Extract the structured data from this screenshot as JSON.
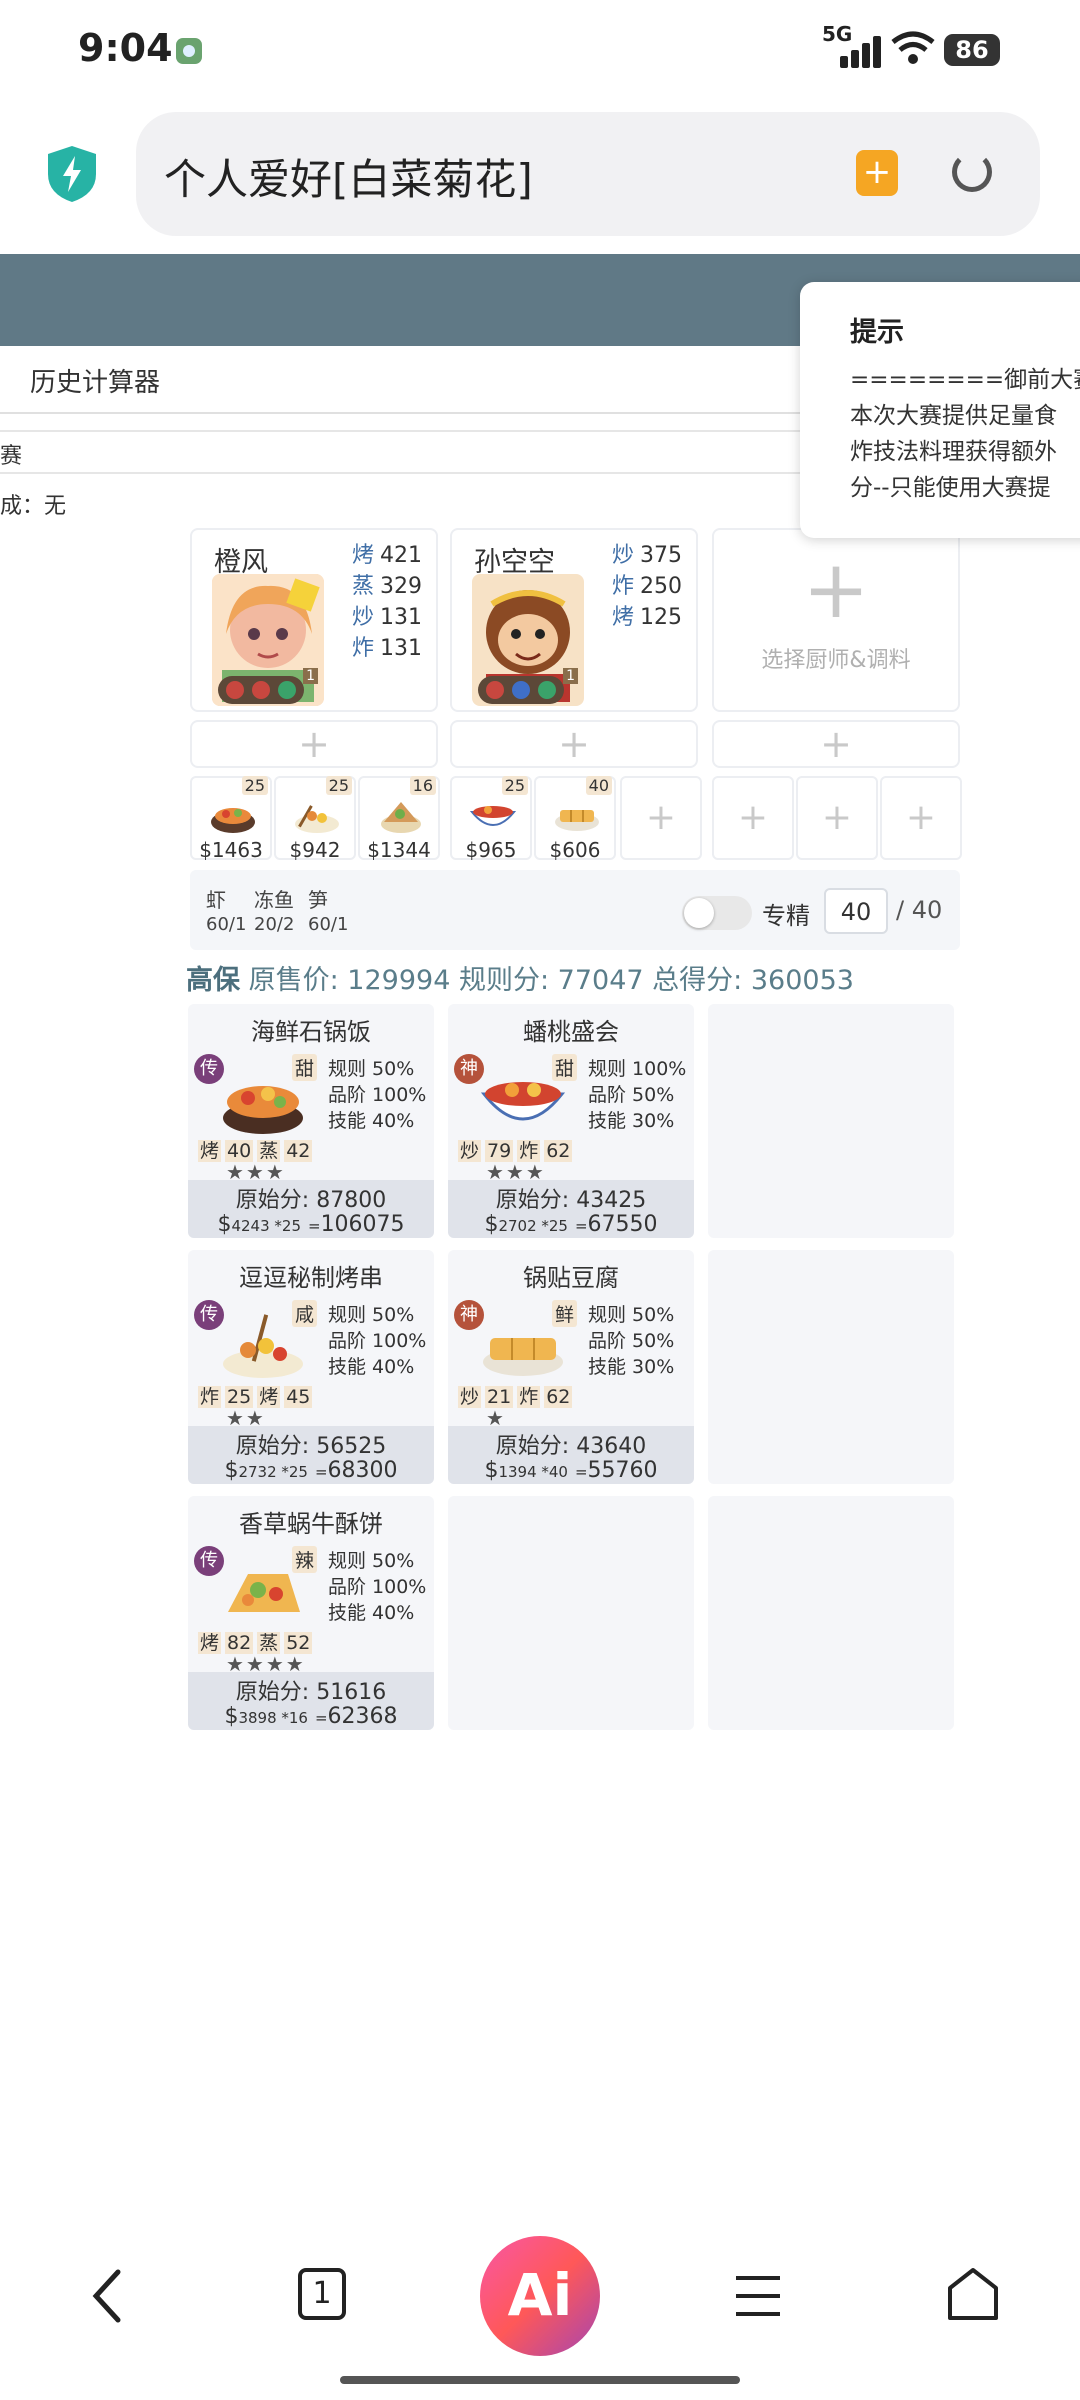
{
  "status_bar": {
    "time": "9:04",
    "network": "5G",
    "battery": "86"
  },
  "browser": {
    "url_title": "个人爱好[白菜菊花]"
  },
  "page": {
    "tab_history": "历史计算器",
    "contest_fragment": "赛",
    "combo_label": "成：无"
  },
  "tooltip": {
    "title": "提示",
    "lines": [
      "========御前大赛",
      "本次大赛提供足量食",
      "炸技法料理获得额外",
      "分--只能使用大赛提"
    ]
  },
  "chefs": [
    {
      "name": "橙风",
      "skills": [
        {
          "type": "烤",
          "value": "421"
        },
        {
          "type": "蒸",
          "value": "329"
        },
        {
          "type": "炒",
          "value": "131"
        },
        {
          "type": "炸",
          "value": "131"
        }
      ],
      "level": "1"
    },
    {
      "name": "孙空空",
      "skills": [
        {
          "type": "炒",
          "value": "375"
        },
        {
          "type": "炸",
          "value": "250"
        },
        {
          "type": "烤",
          "value": "125"
        }
      ],
      "level": "1"
    }
  ],
  "select_chef_label": "选择厨师&调料",
  "recipe_slots": [
    {
      "count": "25",
      "price": "$1463"
    },
    {
      "count": "25",
      "price": "$942"
    },
    {
      "count": "16",
      "price": "$1344"
    },
    {
      "count": "25",
      "price": "$965"
    },
    {
      "count": "40",
      "price": "$606"
    }
  ],
  "ingredients": [
    {
      "name": "虾",
      "amount": "60/1"
    },
    {
      "name": "冻鱼",
      "amount": "20/2"
    },
    {
      "name": "笋",
      "amount": "60/1"
    }
  ],
  "specialize": {
    "label": "专精",
    "value": "40",
    "max": "/ 40"
  },
  "summary": {
    "grade": "高保",
    "sale_label": "原售价:",
    "sale_value": "129994",
    "rule_label": "规则分:",
    "rule_value": "77047",
    "total_label": "总得分:",
    "total_value": "360053"
  },
  "dishes": [
    {
      "title": "海鲜石锅饭",
      "rarity": "传",
      "taste": "甜",
      "rules": [
        "规则 50%",
        "品阶 100%",
        "技能 40%"
      ],
      "attrs": [
        {
          "k": "烤",
          "v": "40"
        },
        {
          "k": "蒸",
          "v": "42"
        }
      ],
      "stars": "★★★",
      "original": "原始分: 87800",
      "calc_price": "$",
      "calc_mid": "4243 *25",
      "calc_eq": "=",
      "calc_total": "106075"
    },
    {
      "title": "蟠桃盛会",
      "rarity": "神",
      "taste": "甜",
      "rules": [
        "规则 100%",
        "品阶 50%",
        "技能 30%"
      ],
      "attrs": [
        {
          "k": "炒",
          "v": "79"
        },
        {
          "k": "炸",
          "v": "62"
        }
      ],
      "stars": "★★★",
      "original": "原始分: 43425",
      "calc_price": "$",
      "calc_mid": "2702 *25",
      "calc_eq": "=",
      "calc_total": "67550"
    },
    {
      "title": "逗逗秘制烤串",
      "rarity": "传",
      "taste": "咸",
      "rules": [
        "规则 50%",
        "品阶 100%",
        "技能 40%"
      ],
      "attrs": [
        {
          "k": "炸",
          "v": "25"
        },
        {
          "k": "烤",
          "v": "45"
        }
      ],
      "stars": "★★",
      "original": "原始分: 56525",
      "calc_price": "$",
      "calc_mid": "2732 *25",
      "calc_eq": "=",
      "calc_total": "68300"
    },
    {
      "title": "锅贴豆腐",
      "rarity": "神",
      "taste": "鲜",
      "rules": [
        "规则 50%",
        "品阶 50%",
        "技能 30%"
      ],
      "attrs": [
        {
          "k": "炒",
          "v": "21"
        },
        {
          "k": "炸",
          "v": "62"
        }
      ],
      "stars": "★",
      "original": "原始分: 43640",
      "calc_price": "$",
      "calc_mid": "1394 *40",
      "calc_eq": "=",
      "calc_total": "55760"
    },
    {
      "title": "香草蜗牛酥饼",
      "rarity": "传",
      "taste": "辣",
      "rules": [
        "规则 50%",
        "品阶 100%",
        "技能 40%"
      ],
      "attrs": [
        {
          "k": "烤",
          "v": "82"
        },
        {
          "k": "蒸",
          "v": "52"
        }
      ],
      "stars": "★★★★",
      "original": "原始分: 51616",
      "calc_price": "$",
      "calc_mid": "3898 *16",
      "calc_eq": "=",
      "calc_total": "62368"
    }
  ],
  "bottom_nav": {
    "tabs_count": "1",
    "ai_label": "Ai"
  },
  "colors": {
    "banner": "#607986",
    "legend_rarity": "#7a3f7a",
    "god_rarity": "#b5523b",
    "accent_orange": "#f5a623"
  }
}
